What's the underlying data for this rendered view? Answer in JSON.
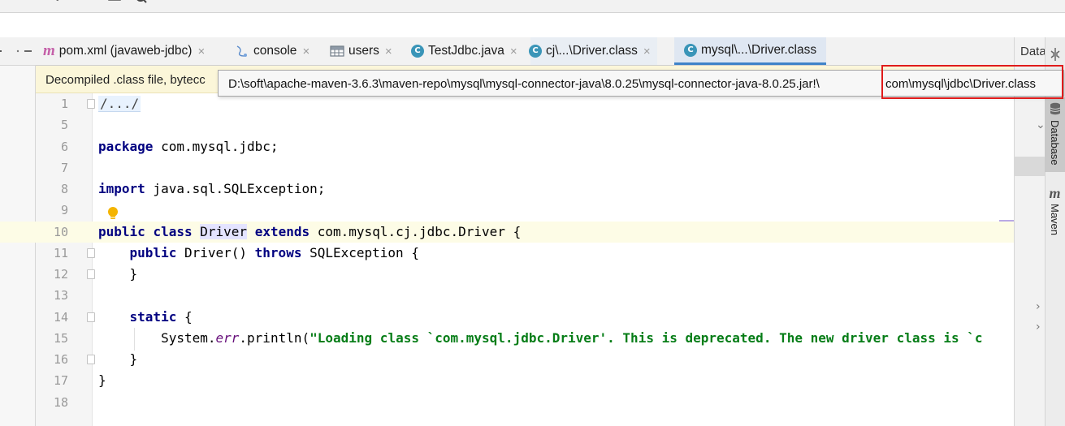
{
  "tabs": [
    {
      "label": "pom.xml (javaweb-jdbc)",
      "icon": "maven-icon"
    },
    {
      "label": "console",
      "icon": "console-icon"
    },
    {
      "label": "users",
      "icon": "table-icon"
    },
    {
      "label": "TestJdbc.java",
      "icon": "class-icon"
    },
    {
      "label": "cj\\...\\Driver.class",
      "icon": "class-icon"
    },
    {
      "label": "mysql\\...\\Driver.class",
      "icon": "class-icon",
      "active": true
    }
  ],
  "class_icon_letter": "C",
  "maven_icon_letter": "m",
  "close_glyph": "×",
  "banner": {
    "text": "Decompiled .class file, bytecc"
  },
  "tooltip": {
    "path_prefix": "D:\\soft\\apache-maven-3.6.3\\maven-repo\\mysql\\mysql-connector-java\\8.0.25\\mysql-connector-java-8.0.25.jar!\\",
    "path_highlighted": "com\\mysql\\jdbc\\Driver.class"
  },
  "right_dock": {
    "panel_title": "Datab",
    "database_tab": "Database",
    "maven_tab": "Maven"
  },
  "editor": {
    "line_numbers": [
      "1",
      "5",
      "6",
      "7",
      "8",
      "9",
      "10",
      "11",
      "12",
      "13",
      "14",
      "15",
      "16",
      "17",
      "18"
    ],
    "current_line": "10",
    "code": {
      "l1": "/.../",
      "l6_kw": "package",
      "l6_rest": " com.mysql.jdbc;",
      "l8_kw": "import",
      "l8_rest": " java.sql.SQLException;",
      "l10_kw1": "public",
      "l10_kw2": "class",
      "l10_name": "Driver",
      "l10_kw3": "extends",
      "l10_rest": " com.mysql.cj.jdbc.Driver {",
      "l11_kw1": "public",
      "l11_mid": " Driver() ",
      "l11_kw2": "throws",
      "l11_rest": " SQLException {",
      "l12": "    }",
      "l14_kw": "static",
      "l14_rest": " {",
      "l15_a": "        System.",
      "l15_field": "err",
      "l15_b": ".println(",
      "l15_str": "\"Loading class `com.mysql.jdbc.Driver'. This is deprecated. The new driver class is `c",
      "l16": "    }",
      "l17": "}"
    }
  },
  "colors": {
    "keyword": "#000080",
    "string": "#067d17",
    "field": "#660e7a",
    "highlight_box": "#e01b1b",
    "active_tab_underline": "#4083c9",
    "banner_bg": "#fbf6d9"
  }
}
